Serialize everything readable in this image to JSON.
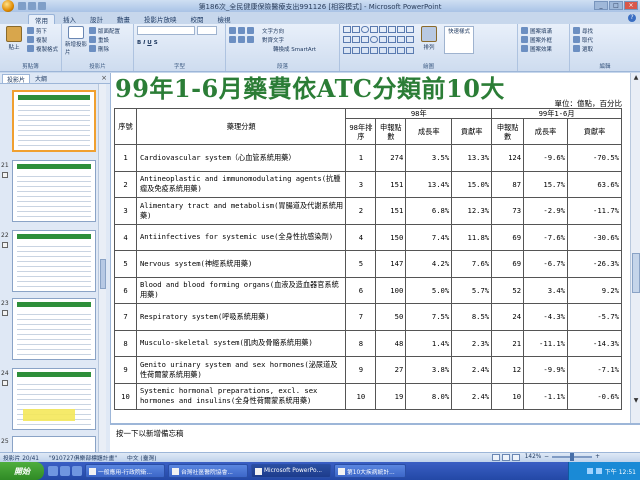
{
  "window": {
    "title": "第186次_全民健康保險醫療支出991126 [相容模式] - Microsoft PowerPoint"
  },
  "ribbon": {
    "tabs": [
      "常用",
      "插入",
      "設計",
      "動畫",
      "投影片放映",
      "校閱",
      "檢視"
    ],
    "active_tab": "常用",
    "groups": {
      "clipboard": {
        "label": "剪貼簿",
        "paste": "貼上",
        "cut": "剪下",
        "copy": "複製",
        "format_painter": "複製格式"
      },
      "slides": {
        "label": "投影片",
        "new_slide": "新增投影片",
        "layout": "版面配置",
        "reset": "重設",
        "delete": "刪除"
      },
      "font": {
        "label": "字型"
      },
      "paragraph": {
        "label": "段落",
        "text_direction": "文字方向",
        "align_text": "對齊文字",
        "smartart": "轉換成 SmartArt"
      },
      "drawing": {
        "label": "繪圖",
        "arrange": "排列",
        "quick_styles": "快速樣式",
        "fill": "圖案填滿",
        "outline": "圖案外框",
        "effects": "圖案效果"
      },
      "editing": {
        "label": "編輯",
        "find": "尋找",
        "replace": "取代",
        "select": "選取"
      }
    }
  },
  "panel": {
    "tabs": [
      "投影片",
      "大綱"
    ],
    "active_tab": "投影片",
    "close": "×"
  },
  "thumbnails": [
    {
      "num": "",
      "title": "99年第1-6月核付醫療費用依ATC分類前10大疾病",
      "selected": true
    },
    {
      "num": "21",
      "title": "99年第1-6月門住診前十大疾病(1/2)",
      "selected": false
    },
    {
      "num": "22",
      "title": "99年第1-6月門住診前十大疾病(2/2)",
      "selected": false
    },
    {
      "num": "23",
      "title": "99年第1-6月藥品費用前十大藥品",
      "selected": false
    },
    {
      "num": "24",
      "title": "99年第1-6月特約院所核付點數分析",
      "selected": false
    },
    {
      "num": "25",
      "title": "",
      "selected": false
    }
  ],
  "slide": {
    "title": "99年1-6月藥費依ATC分類前10大",
    "unit": "單位：億點，百分比",
    "headers": {
      "rank": "序號",
      "category": "藥理分類",
      "period_98": "98年",
      "period_99": "99年1-6月",
      "rank98": "98年排序",
      "points": "申報點數",
      "growth": "成長率",
      "share": "貢獻率"
    },
    "rows": [
      {
        "rank": "1",
        "name": "Cardiovascular system（心血管系統用藥）",
        "rank98": "1",
        "p98": "274",
        "g98": "3.5%",
        "s98": "13.3%",
        "p99": "124",
        "g99": "-9.6%",
        "s99": "-70.5%"
      },
      {
        "rank": "2",
        "name": "Antineoplastic and immunomodulating agents(抗腫瘤及免疫系統用藥)",
        "rank98": "3",
        "p98": "151",
        "g98": "13.4%",
        "s98": "15.0%",
        "p99": "87",
        "g99": "15.7%",
        "s99": "63.6%"
      },
      {
        "rank": "3",
        "name": "Alimentary tract and metabolism(胃腸道及代謝系統用藥)",
        "rank98": "2",
        "p98": "151",
        "g98": "6.8%",
        "s98": "12.3%",
        "p99": "73",
        "g99": "-2.9%",
        "s99": "-11.7%"
      },
      {
        "rank": "4",
        "name": "Antiinfectives for systemic use(全身性抗感染劑)",
        "rank98": "4",
        "p98": "150",
        "g98": "7.4%",
        "s98": "11.8%",
        "p99": "69",
        "g99": "-7.6%",
        "s99": "-30.6%"
      },
      {
        "rank": "5",
        "name": "Nervous system(神經系統用藥)",
        "rank98": "5",
        "p98": "147",
        "g98": "4.2%",
        "s98": "7.6%",
        "p99": "69",
        "g99": "-6.7%",
        "s99": "-26.3%"
      },
      {
        "rank": "6",
        "name": "Blood and blood forming organs(血液及造血器官系統用藥)",
        "rank98": "6",
        "p98": "100",
        "g98": "5.0%",
        "s98": "5.7%",
        "p99": "52",
        "g99": "3.4%",
        "s99": "9.2%"
      },
      {
        "rank": "7",
        "name": "Respiratory system(呼吸系統用藥)",
        "rank98": "7",
        "p98": "50",
        "g98": "7.5%",
        "s98": "8.5%",
        "p99": "24",
        "g99": "-4.3%",
        "s99": "-5.7%"
      },
      {
        "rank": "8",
        "name": "Musculo-skeletal system(肌肉及骨骼系統用藥)",
        "rank98": "8",
        "p98": "48",
        "g98": "1.4%",
        "s98": "2.3%",
        "p99": "21",
        "g99": "-11.1%",
        "s99": "-14.3%"
      },
      {
        "rank": "9",
        "name": "Genito urinary system and sex hormones(泌尿道及性荷爾蒙系統用藥)",
        "rank98": "9",
        "p98": "27",
        "g98": "3.8%",
        "s98": "2.4%",
        "p99": "12",
        "g99": "-9.9%",
        "s99": "-7.1%"
      },
      {
        "rank": "10",
        "name": "Systemic hormonal preparations, excl. sex hormones and insulins(全身性荷爾蒙系統用藥)",
        "rank98": "10",
        "p98": "19",
        "g98": "8.0%",
        "s98": "2.4%",
        "p99": "10",
        "g99": "-1.1%",
        "s99": "-0.6%"
      }
    ]
  },
  "notes": {
    "placeholder": "按一下以新增備忘稿"
  },
  "status": {
    "slide": "投影片 20/41",
    "theme": "\"910727俱樂部標題計畫\"",
    "language": "中文 (臺灣)",
    "zoom": "142%"
  },
  "taskbar": {
    "start": "開始",
    "buttons": [
      "一般應用-行政院衛...",
      "台灣社區醫院協會...",
      "Microsoft PowerPo...",
      "第10大疾病統計..."
    ],
    "active_index": 2,
    "clock": "下午 12:51"
  }
}
